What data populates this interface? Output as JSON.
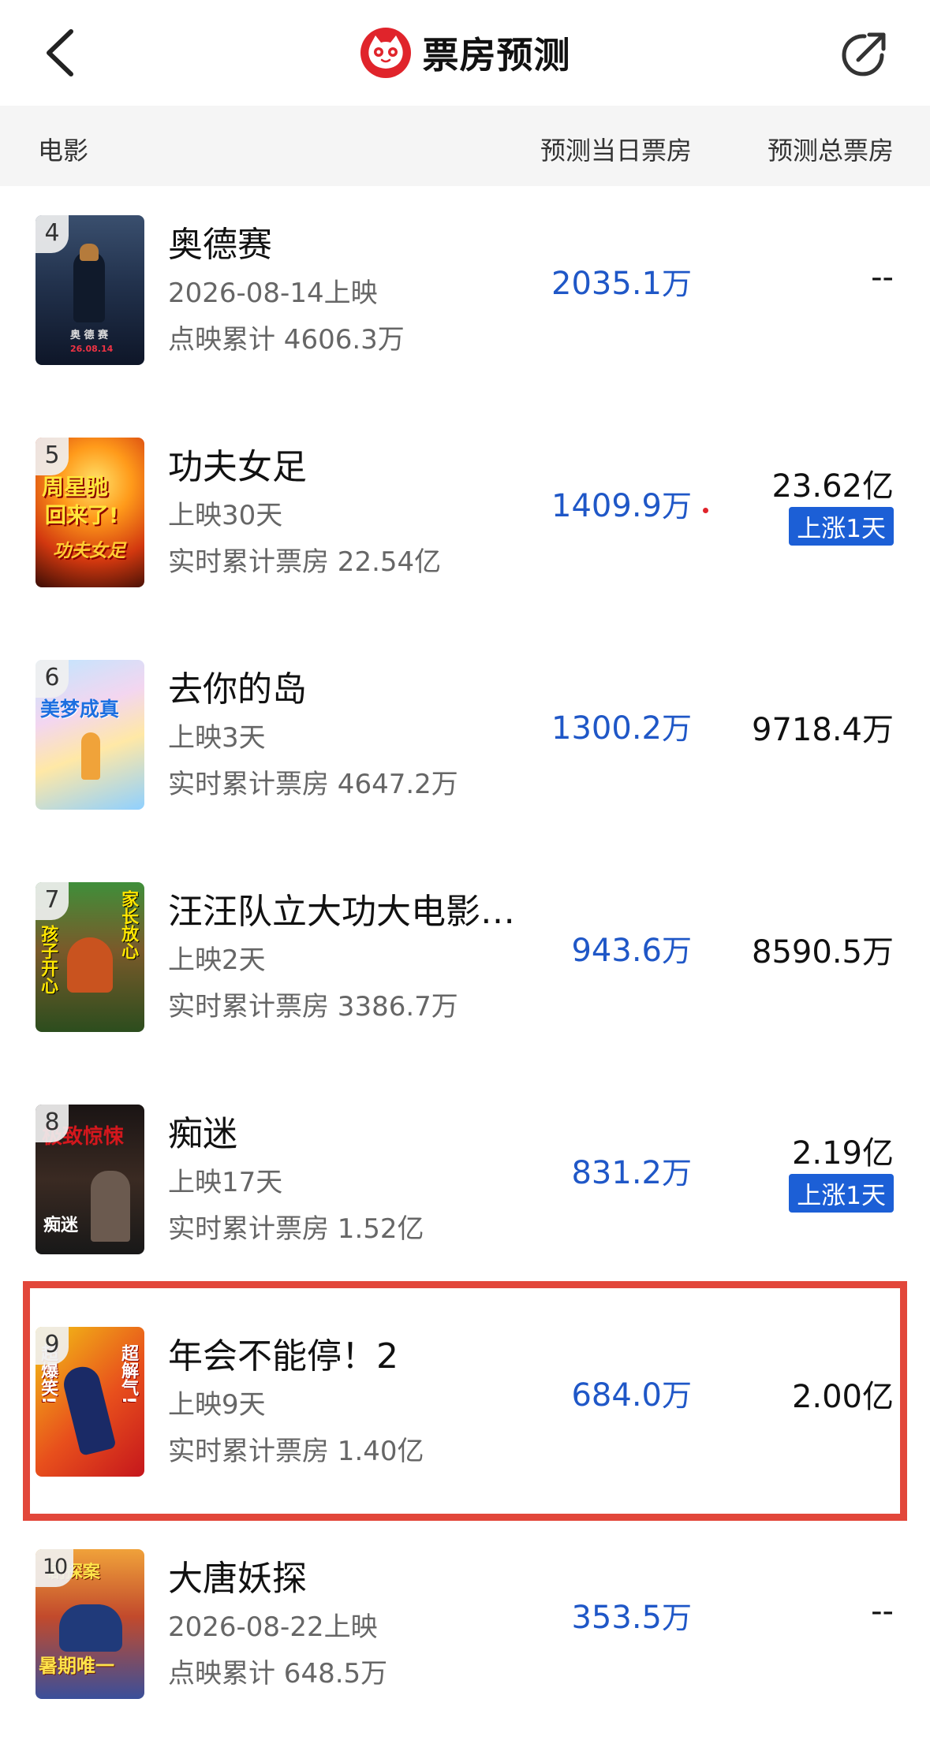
{
  "nav": {
    "title": "票房预测",
    "back_icon": "chevron-left-icon",
    "share_icon": "share-arrow-icon",
    "logo_icon": "cat-logo-icon",
    "logo_color": "#e0242b"
  },
  "table_header": {
    "movie": "电影",
    "daily_forecast": "预测当日票房",
    "total_forecast": "预测总票房"
  },
  "colors": {
    "accent_blue": "#1f57c7",
    "badge_blue": "#1c5fd6",
    "highlight_red": "#e2473a"
  },
  "movies": [
    {
      "rank": "4",
      "name": "奥德赛",
      "sub1": "2026-08-14上映",
      "sub2": "点映累计 4606.3万",
      "daily_value": "2035.1",
      "daily_unit": "万",
      "total": "--",
      "badge": "",
      "poster_text": [
        "奥 德 赛",
        "26.08.14"
      ]
    },
    {
      "rank": "5",
      "name": "功夫女足",
      "sub1": "上映30天",
      "sub2": "实时累计票房 22.54亿",
      "daily_value": "1409.9",
      "daily_unit": "万",
      "total": "23.62亿",
      "badge": "上涨1天",
      "poster_text": [
        "周星驰",
        "回来了!",
        "功夫女足"
      ]
    },
    {
      "rank": "6",
      "name": "去你的岛",
      "sub1": "上映3天",
      "sub2": "实时累计票房 4647.2万",
      "daily_value": "1300.2",
      "daily_unit": "万",
      "total": "9718.4万",
      "badge": "",
      "poster_text": [
        "美梦成真"
      ]
    },
    {
      "rank": "7",
      "name": "汪汪队立大功大电影…",
      "sub1": "上映2天",
      "sub2": "实时累计票房 3386.7万",
      "daily_value": "943.6",
      "daily_unit": "万",
      "total": "8590.5万",
      "badge": "",
      "poster_text": [
        "孩子开心",
        "家长放心"
      ]
    },
    {
      "rank": "8",
      "name": "痴迷",
      "sub1": "上映17天",
      "sub2": "实时累计票房 1.52亿",
      "daily_value": "831.2",
      "daily_unit": "万",
      "total": "2.19亿",
      "badge": "上涨1天",
      "poster_text": [
        "极致惊悚",
        "痴迷"
      ]
    },
    {
      "rank": "9",
      "name": "年会不能停！2",
      "sub1": "上映9天",
      "sub2": "实时累计票房 1.40亿",
      "daily_value": "684.0",
      "daily_unit": "万",
      "total": "2.00亿",
      "badge": "",
      "poster_text": [
        "超爆笑!",
        "超解气!"
      ]
    },
    {
      "rank": "10",
      "name": "大唐妖探",
      "sub1": "2026-08-22上映",
      "sub2": "点映累计 648.5万",
      "daily_value": "353.5",
      "daily_unit": "万",
      "total": "--",
      "badge": "",
      "poster_text": [
        "剧探案",
        "暑期唯一"
      ]
    }
  ]
}
